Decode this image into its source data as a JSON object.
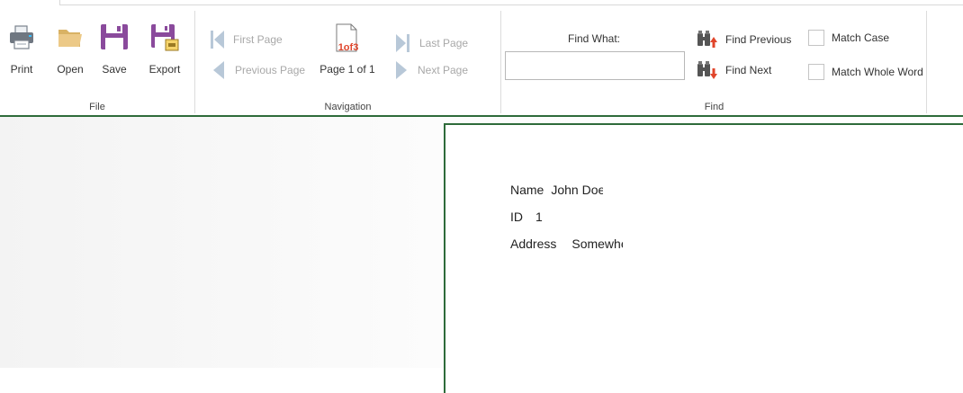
{
  "ribbon": {
    "file": {
      "group_label": "File",
      "print_label": "Print",
      "open_label": "Open",
      "save_label": "Save",
      "export_label": "Export"
    },
    "navigation": {
      "group_label": "Navigation",
      "first_page_label": "First Page",
      "previous_page_label": "Previous Page",
      "page_icon_text": "1of3",
      "page_status": "Page 1 of 1",
      "last_page_label": "Last Page",
      "next_page_label": "Next Page"
    },
    "find": {
      "group_label": "Find",
      "find_what_label": "Find What:",
      "find_value": "",
      "find_previous_label": "Find Previous",
      "find_next_label": "Find Next",
      "match_case_label": "Match Case",
      "match_case_checked": false,
      "match_whole_word_label": "Match Whole Word",
      "match_whole_word_checked": false
    }
  },
  "report": {
    "name_label": "Name",
    "name_value": "John Doe",
    "id_label": "ID",
    "id_value": "1",
    "address_label": "Address",
    "address_value": "Somewhere"
  },
  "colors": {
    "accent_green": "#2e6b3a",
    "save_purple": "#8a4a9c",
    "folder_tan": "#e6c27a",
    "find_arrow_red": "#e0452b",
    "disabled_nav": "#b8c8d8"
  },
  "icons": {
    "print": "printer-icon",
    "open": "folder-icon",
    "save": "floppy-disk-icon",
    "export": "export-icon",
    "first_page": "first-page-icon",
    "previous_page": "previous-page-icon",
    "page": "page-document-icon",
    "last_page": "last-page-icon",
    "next_page": "next-page-icon",
    "find_previous": "binoculars-up-icon",
    "find_next": "binoculars-down-icon"
  }
}
